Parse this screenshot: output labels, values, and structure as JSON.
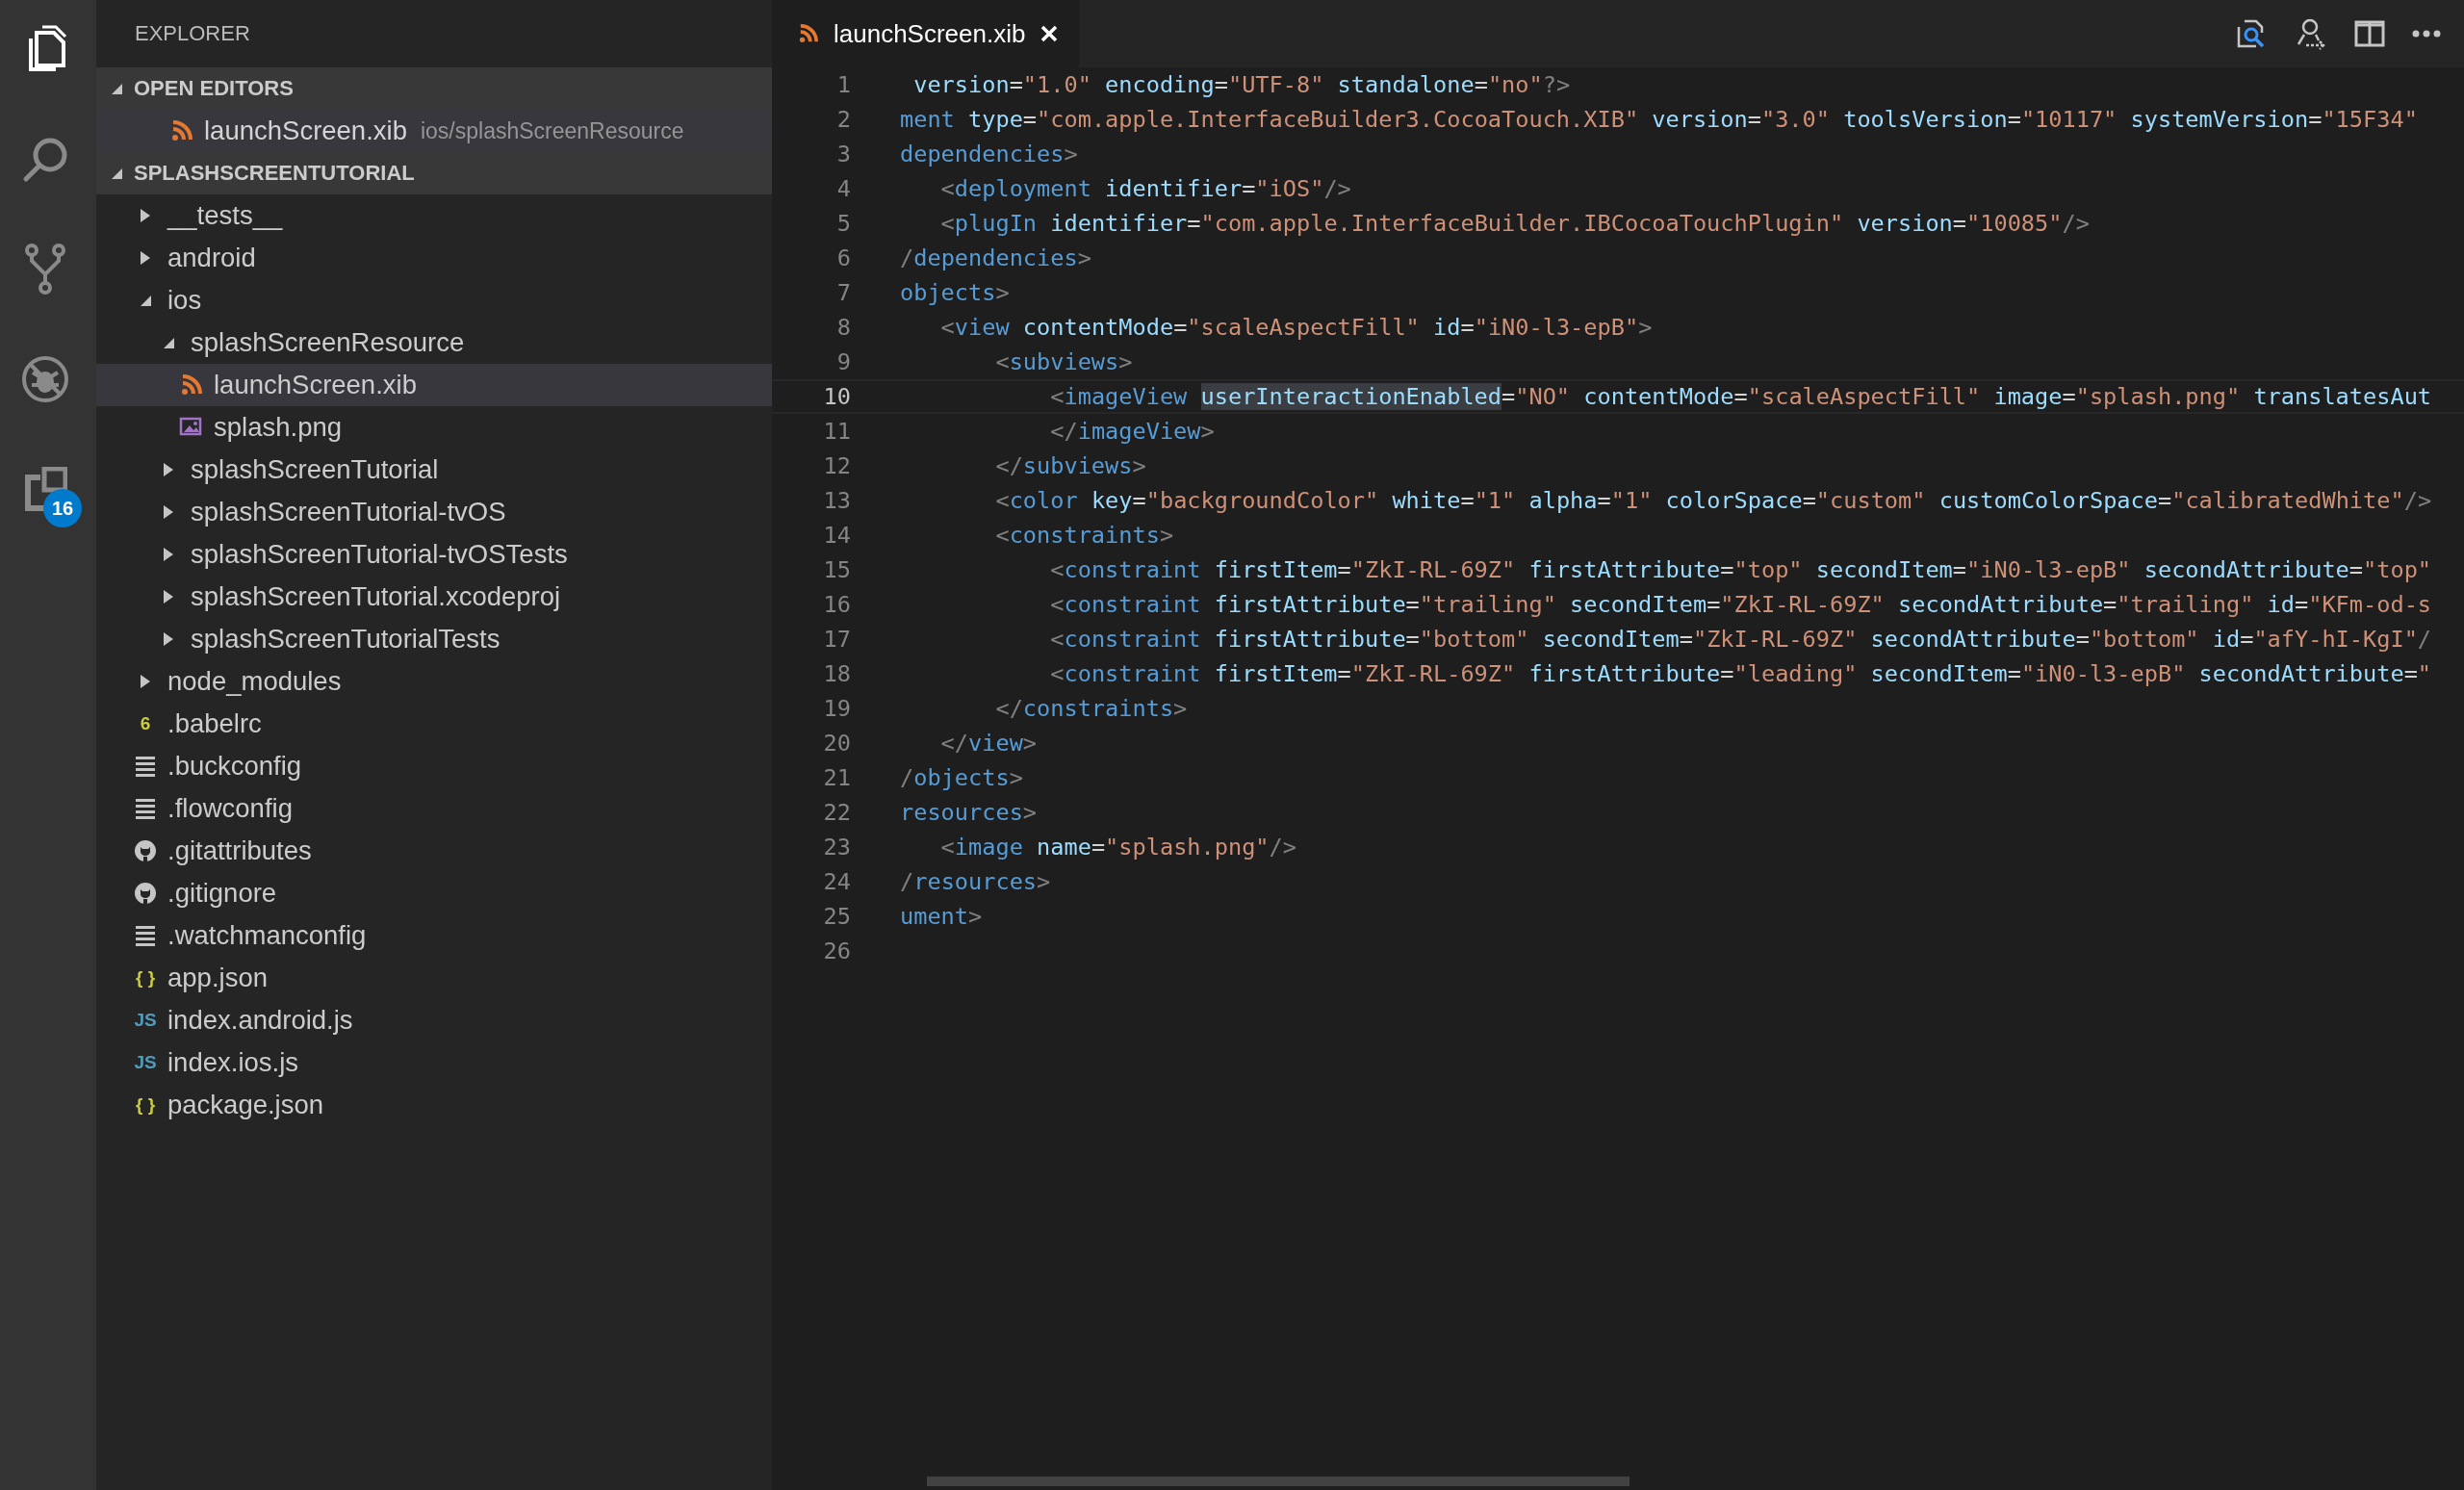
{
  "activity_bar": [
    {
      "kind": "files",
      "selected": true
    },
    {
      "kind": "search",
      "selected": false
    },
    {
      "kind": "git",
      "selected": false
    },
    {
      "kind": "debug",
      "selected": false
    },
    {
      "kind": "extensions",
      "selected": false,
      "badge": "16"
    }
  ],
  "sidebar": {
    "title": "EXPLORER",
    "open_editors": {
      "title": "OPEN EDITORS",
      "expanded": true,
      "items": [
        {
          "name": "launchScreen.xib",
          "path": "ios/splashScreenResource",
          "kind": "xml",
          "selected": true
        }
      ]
    },
    "project": {
      "title": "SPLASHSCREENTUTORIAL",
      "expanded": true,
      "tree": [
        {
          "name": "__tests__",
          "kind": "folder",
          "expanded": false,
          "selected": false
        },
        {
          "name": "android",
          "kind": "folder",
          "expanded": false,
          "selected": false
        },
        {
          "name": "ios",
          "kind": "folder",
          "expanded": true,
          "selected": false,
          "children": [
            {
              "name": "splashScreenResource",
              "kind": "folder",
              "expanded": true,
              "selected": false,
              "children": [
                {
                  "name": "launchScreen.xib",
                  "kind": "xml",
                  "selected": true
                },
                {
                  "name": "splash.png",
                  "kind": "image",
                  "selected": false
                }
              ]
            },
            {
              "name": "splashScreenTutorial",
              "kind": "folder",
              "expanded": false,
              "selected": false
            },
            {
              "name": "splashScreenTutorial-tvOS",
              "kind": "folder",
              "expanded": false,
              "selected": false
            },
            {
              "name": "splashScreenTutorial-tvOSTests",
              "kind": "folder",
              "expanded": false,
              "selected": false
            },
            {
              "name": "splashScreenTutorial.xcodeproj",
              "kind": "folder",
              "expanded": false,
              "selected": false
            },
            {
              "name": "splashScreenTutorialTests",
              "kind": "folder",
              "expanded": false,
              "selected": false
            }
          ]
        },
        {
          "name": "node_modules",
          "kind": "folder",
          "expanded": false,
          "selected": false
        },
        {
          "name": ".babelrc",
          "kind": "babel",
          "glyph": "6",
          "selected": false
        },
        {
          "name": ".buckconfig",
          "kind": "config",
          "selected": false
        },
        {
          "name": ".flowconfig",
          "kind": "config",
          "selected": false
        },
        {
          "name": ".gitattributes",
          "kind": "github",
          "selected": false
        },
        {
          "name": ".gitignore",
          "kind": "github",
          "selected": false
        },
        {
          "name": ".watchmanconfig",
          "kind": "config",
          "selected": false
        },
        {
          "name": "app.json",
          "kind": "json",
          "glyph": "{ }",
          "selected": false
        },
        {
          "name": "index.android.js",
          "kind": "js",
          "glyph": "JS",
          "selected": false
        },
        {
          "name": "index.ios.js",
          "kind": "js",
          "glyph": "JS",
          "selected": false
        },
        {
          "name": "package.json",
          "kind": "json",
          "glyph": "{ }",
          "selected": false
        }
      ]
    }
  },
  "tabs": [
    {
      "title": "launchScreen.xib",
      "kind": "xml",
      "selected": true
    }
  ],
  "editor": {
    "lines": [
      {
        "number": "1",
        "current": false,
        "tokens": [
          {
            "kind": "attr",
            "text": " version"
          },
          {
            "kind": "plain",
            "text": "="
          },
          {
            "kind": "string",
            "text": "\"1.0\""
          },
          {
            "kind": "attr",
            "text": " encoding"
          },
          {
            "kind": "plain",
            "text": "="
          },
          {
            "kind": "string",
            "text": "\"UTF-8\""
          },
          {
            "kind": "attr",
            "text": " standalone"
          },
          {
            "kind": "plain",
            "text": "="
          },
          {
            "kind": "string",
            "text": "\"no\""
          },
          {
            "kind": "punct",
            "text": "?>"
          }
        ]
      },
      {
        "number": "2",
        "current": false,
        "tokens": [
          {
            "kind": "tag",
            "text": "ment"
          },
          {
            "kind": "attr",
            "text": " type"
          },
          {
            "kind": "plain",
            "text": "="
          },
          {
            "kind": "string",
            "text": "\"com.apple.InterfaceBuilder3.CocoaTouch.XIB\""
          },
          {
            "kind": "attr",
            "text": " version"
          },
          {
            "kind": "plain",
            "text": "="
          },
          {
            "kind": "string",
            "text": "\"3.0\""
          },
          {
            "kind": "attr",
            "text": " toolsVersion"
          },
          {
            "kind": "plain",
            "text": "="
          },
          {
            "kind": "string",
            "text": "\"10117\""
          },
          {
            "kind": "attr",
            "text": " systemVersion"
          },
          {
            "kind": "plain",
            "text": "="
          },
          {
            "kind": "string",
            "text": "\"15F34\""
          }
        ]
      },
      {
        "number": "3",
        "current": false,
        "tokens": [
          {
            "kind": "tag",
            "text": "dependencies"
          },
          {
            "kind": "punct",
            "text": ">"
          }
        ]
      },
      {
        "number": "4",
        "current": false,
        "tokens": [
          {
            "kind": "punct",
            "text": "   <"
          },
          {
            "kind": "tag",
            "text": "deployment"
          },
          {
            "kind": "attr",
            "text": " identifier"
          },
          {
            "kind": "plain",
            "text": "="
          },
          {
            "kind": "string",
            "text": "\"iOS\""
          },
          {
            "kind": "punct",
            "text": "/>"
          }
        ]
      },
      {
        "number": "5",
        "current": false,
        "tokens": [
          {
            "kind": "punct",
            "text": "   <"
          },
          {
            "kind": "tag",
            "text": "plugIn"
          },
          {
            "kind": "attr",
            "text": " identifier"
          },
          {
            "kind": "plain",
            "text": "="
          },
          {
            "kind": "string",
            "text": "\"com.apple.InterfaceBuilder.IBCocoaTouchPlugin\""
          },
          {
            "kind": "attr",
            "text": " version"
          },
          {
            "kind": "plain",
            "text": "="
          },
          {
            "kind": "string",
            "text": "\"10085\""
          },
          {
            "kind": "punct",
            "text": "/>"
          }
        ]
      },
      {
        "number": "6",
        "current": false,
        "tokens": [
          {
            "kind": "punct",
            "text": "/"
          },
          {
            "kind": "tag",
            "text": "dependencies"
          },
          {
            "kind": "punct",
            "text": ">"
          }
        ]
      },
      {
        "number": "7",
        "current": false,
        "tokens": [
          {
            "kind": "tag",
            "text": "objects"
          },
          {
            "kind": "punct",
            "text": ">"
          }
        ]
      },
      {
        "number": "8",
        "current": false,
        "tokens": [
          {
            "kind": "punct",
            "text": "   <"
          },
          {
            "kind": "tag",
            "text": "view"
          },
          {
            "kind": "attr",
            "text": " contentMode"
          },
          {
            "kind": "plain",
            "text": "="
          },
          {
            "kind": "string",
            "text": "\"scaleAspectFill\""
          },
          {
            "kind": "attr",
            "text": " id"
          },
          {
            "kind": "plain",
            "text": "="
          },
          {
            "kind": "string",
            "text": "\"iN0-l3-epB\""
          },
          {
            "kind": "punct",
            "text": ">"
          }
        ]
      },
      {
        "number": "9",
        "current": false,
        "tokens": [
          {
            "kind": "punct",
            "text": "       <"
          },
          {
            "kind": "tag",
            "text": "subviews"
          },
          {
            "kind": "punct",
            "text": ">"
          }
        ]
      },
      {
        "number": "10",
        "current": true,
        "tokens": [
          {
            "kind": "punct",
            "text": "           <"
          },
          {
            "kind": "tag",
            "text": "imageView "
          },
          {
            "kind": "match",
            "text": "userInteractionEnabled"
          },
          {
            "kind": "plain",
            "text": "="
          },
          {
            "kind": "string",
            "text": "\"NO\""
          },
          {
            "kind": "attr",
            "text": " contentMode"
          },
          {
            "kind": "plain",
            "text": "="
          },
          {
            "kind": "string",
            "text": "\"scaleAspectFill\""
          },
          {
            "kind": "attr",
            "text": " image"
          },
          {
            "kind": "plain",
            "text": "="
          },
          {
            "kind": "string",
            "text": "\"splash.png\""
          },
          {
            "kind": "attr",
            "text": " translatesAut"
          }
        ]
      },
      {
        "number": "11",
        "current": false,
        "tokens": [
          {
            "kind": "punct",
            "text": "           </"
          },
          {
            "kind": "tag",
            "text": "imageView"
          },
          {
            "kind": "punct",
            "text": ">"
          }
        ]
      },
      {
        "number": "12",
        "current": false,
        "tokens": [
          {
            "kind": "punct",
            "text": "       </"
          },
          {
            "kind": "tag",
            "text": "subviews"
          },
          {
            "kind": "punct",
            "text": ">"
          }
        ]
      },
      {
        "number": "13",
        "current": false,
        "tokens": [
          {
            "kind": "punct",
            "text": "       <"
          },
          {
            "kind": "tag",
            "text": "color"
          },
          {
            "kind": "attr",
            "text": " key"
          },
          {
            "kind": "plain",
            "text": "="
          },
          {
            "kind": "string",
            "text": "\"backgroundColor\""
          },
          {
            "kind": "attr",
            "text": " white"
          },
          {
            "kind": "plain",
            "text": "="
          },
          {
            "kind": "string",
            "text": "\"1\""
          },
          {
            "kind": "attr",
            "text": " alpha"
          },
          {
            "kind": "plain",
            "text": "="
          },
          {
            "kind": "string",
            "text": "\"1\""
          },
          {
            "kind": "attr",
            "text": " colorSpace"
          },
          {
            "kind": "plain",
            "text": "="
          },
          {
            "kind": "string",
            "text": "\"custom\""
          },
          {
            "kind": "attr",
            "text": " customColorSpace"
          },
          {
            "kind": "plain",
            "text": "="
          },
          {
            "kind": "string",
            "text": "\"calibratedWhite\""
          },
          {
            "kind": "punct",
            "text": "/>"
          }
        ]
      },
      {
        "number": "14",
        "current": false,
        "tokens": [
          {
            "kind": "punct",
            "text": "       <"
          },
          {
            "kind": "tag",
            "text": "constraints"
          },
          {
            "kind": "punct",
            "text": ">"
          }
        ]
      },
      {
        "number": "15",
        "current": false,
        "tokens": [
          {
            "kind": "punct",
            "text": "           <"
          },
          {
            "kind": "tag",
            "text": "constraint"
          },
          {
            "kind": "attr",
            "text": " firstItem"
          },
          {
            "kind": "plain",
            "text": "="
          },
          {
            "kind": "string",
            "text": "\"ZkI-RL-69Z\""
          },
          {
            "kind": "attr",
            "text": " firstAttribute"
          },
          {
            "kind": "plain",
            "text": "="
          },
          {
            "kind": "string",
            "text": "\"top\""
          },
          {
            "kind": "attr",
            "text": " secondItem"
          },
          {
            "kind": "plain",
            "text": "="
          },
          {
            "kind": "string",
            "text": "\"iN0-l3-epB\""
          },
          {
            "kind": "attr",
            "text": " secondAttribute"
          },
          {
            "kind": "plain",
            "text": "="
          },
          {
            "kind": "string",
            "text": "\"top\""
          }
        ]
      },
      {
        "number": "16",
        "current": false,
        "tokens": [
          {
            "kind": "punct",
            "text": "           <"
          },
          {
            "kind": "tag",
            "text": "constraint"
          },
          {
            "kind": "attr",
            "text": " firstAttribute"
          },
          {
            "kind": "plain",
            "text": "="
          },
          {
            "kind": "string",
            "text": "\"trailing\""
          },
          {
            "kind": "attr",
            "text": " secondItem"
          },
          {
            "kind": "plain",
            "text": "="
          },
          {
            "kind": "string",
            "text": "\"ZkI-RL-69Z\""
          },
          {
            "kind": "attr",
            "text": " secondAttribute"
          },
          {
            "kind": "plain",
            "text": "="
          },
          {
            "kind": "string",
            "text": "\"trailing\""
          },
          {
            "kind": "attr",
            "text": " id"
          },
          {
            "kind": "plain",
            "text": "="
          },
          {
            "kind": "string",
            "text": "\"KFm-od-s"
          }
        ]
      },
      {
        "number": "17",
        "current": false,
        "tokens": [
          {
            "kind": "punct",
            "text": "           <"
          },
          {
            "kind": "tag",
            "text": "constraint"
          },
          {
            "kind": "attr",
            "text": " firstAttribute"
          },
          {
            "kind": "plain",
            "text": "="
          },
          {
            "kind": "string",
            "text": "\"bottom\""
          },
          {
            "kind": "attr",
            "text": " secondItem"
          },
          {
            "kind": "plain",
            "text": "="
          },
          {
            "kind": "string",
            "text": "\"ZkI-RL-69Z\""
          },
          {
            "kind": "attr",
            "text": " secondAttribute"
          },
          {
            "kind": "plain",
            "text": "="
          },
          {
            "kind": "string",
            "text": "\"bottom\""
          },
          {
            "kind": "attr",
            "text": " id"
          },
          {
            "kind": "plain",
            "text": "="
          },
          {
            "kind": "string",
            "text": "\"afY-hI-KgI\""
          },
          {
            "kind": "punct",
            "text": "/"
          }
        ]
      },
      {
        "number": "18",
        "current": false,
        "tokens": [
          {
            "kind": "punct",
            "text": "           <"
          },
          {
            "kind": "tag",
            "text": "constraint"
          },
          {
            "kind": "attr",
            "text": " firstItem"
          },
          {
            "kind": "plain",
            "text": "="
          },
          {
            "kind": "string",
            "text": "\"ZkI-RL-69Z\""
          },
          {
            "kind": "attr",
            "text": " firstAttribute"
          },
          {
            "kind": "plain",
            "text": "="
          },
          {
            "kind": "string",
            "text": "\"leading\""
          },
          {
            "kind": "attr",
            "text": " secondItem"
          },
          {
            "kind": "plain",
            "text": "="
          },
          {
            "kind": "string",
            "text": "\"iN0-l3-epB\""
          },
          {
            "kind": "attr",
            "text": " secondAttribute"
          },
          {
            "kind": "plain",
            "text": "="
          },
          {
            "kind": "string",
            "text": "\""
          }
        ]
      },
      {
        "number": "19",
        "current": false,
        "tokens": [
          {
            "kind": "punct",
            "text": "       </"
          },
          {
            "kind": "tag",
            "text": "constraints"
          },
          {
            "kind": "punct",
            "text": ">"
          }
        ]
      },
      {
        "number": "20",
        "current": false,
        "tokens": [
          {
            "kind": "punct",
            "text": "   </"
          },
          {
            "kind": "tag",
            "text": "view"
          },
          {
            "kind": "punct",
            "text": ">"
          }
        ]
      },
      {
        "number": "21",
        "current": false,
        "tokens": [
          {
            "kind": "punct",
            "text": "/"
          },
          {
            "kind": "tag",
            "text": "objects"
          },
          {
            "kind": "punct",
            "text": ">"
          }
        ]
      },
      {
        "number": "22",
        "current": false,
        "tokens": [
          {
            "kind": "tag",
            "text": "resources"
          },
          {
            "kind": "punct",
            "text": ">"
          }
        ]
      },
      {
        "number": "23",
        "current": false,
        "tokens": [
          {
            "kind": "punct",
            "text": "   <"
          },
          {
            "kind": "tag",
            "text": "image"
          },
          {
            "kind": "attr",
            "text": " name"
          },
          {
            "kind": "plain",
            "text": "="
          },
          {
            "kind": "string",
            "text": "\"splash.png\""
          },
          {
            "kind": "punct",
            "text": "/>"
          }
        ]
      },
      {
        "number": "24",
        "current": false,
        "tokens": [
          {
            "kind": "punct",
            "text": "/"
          },
          {
            "kind": "tag",
            "text": "resources"
          },
          {
            "kind": "punct",
            "text": ">"
          }
        ]
      },
      {
        "number": "25",
        "current": false,
        "tokens": [
          {
            "kind": "tag",
            "text": "ument"
          },
          {
            "kind": "punct",
            "text": ">"
          }
        ]
      },
      {
        "number": "26",
        "current": false
      }
    ]
  }
}
